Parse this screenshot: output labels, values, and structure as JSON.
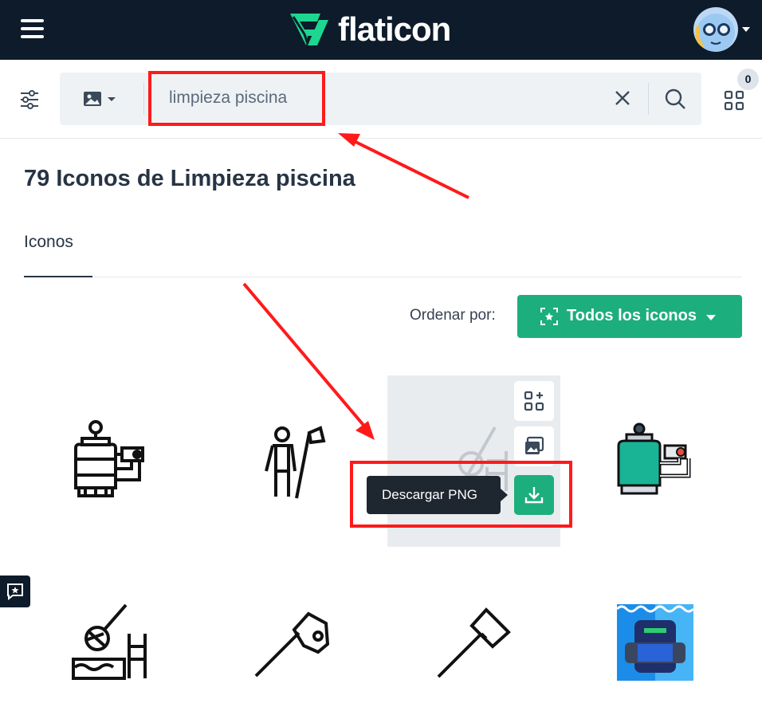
{
  "header": {
    "brand": "flaticon",
    "menu_icon": "hamburger-icon",
    "avatar_icon": "user-avatar"
  },
  "search": {
    "value": "limpieza piscina",
    "filters_icon": "sliders-icon",
    "type_icon": "image-icon",
    "clear_icon": "close-icon",
    "search_icon": "search-icon",
    "collections_icon": "grid-icon",
    "collections_count": "0"
  },
  "results": {
    "title": "79 Iconos de Limpieza piscina",
    "tab_label": "Iconos",
    "sort_label": "Ordenar por:",
    "sort_value": "Todos los iconos"
  },
  "hover_card": {
    "tooltip": "Descargar PNG",
    "actions": [
      "add-to-collection-icon",
      "edit-image-icon",
      "download-icon"
    ]
  },
  "icons": [
    {
      "name": "pool-filter-pump-outline"
    },
    {
      "name": "pool-cleaner-person-outline"
    },
    {
      "name": "pool-skimmer-ladder-outline"
    },
    {
      "name": "pool-filter-pump-color"
    },
    {
      "name": "pool-skimmer-net-water"
    },
    {
      "name": "pool-vacuum-head"
    },
    {
      "name": "pool-brush"
    },
    {
      "name": "pool-robot-cleaner"
    }
  ],
  "colors": {
    "topbar": "#0d1b2a",
    "accent": "#1dae7d",
    "annotation": "#ff1a1a"
  }
}
